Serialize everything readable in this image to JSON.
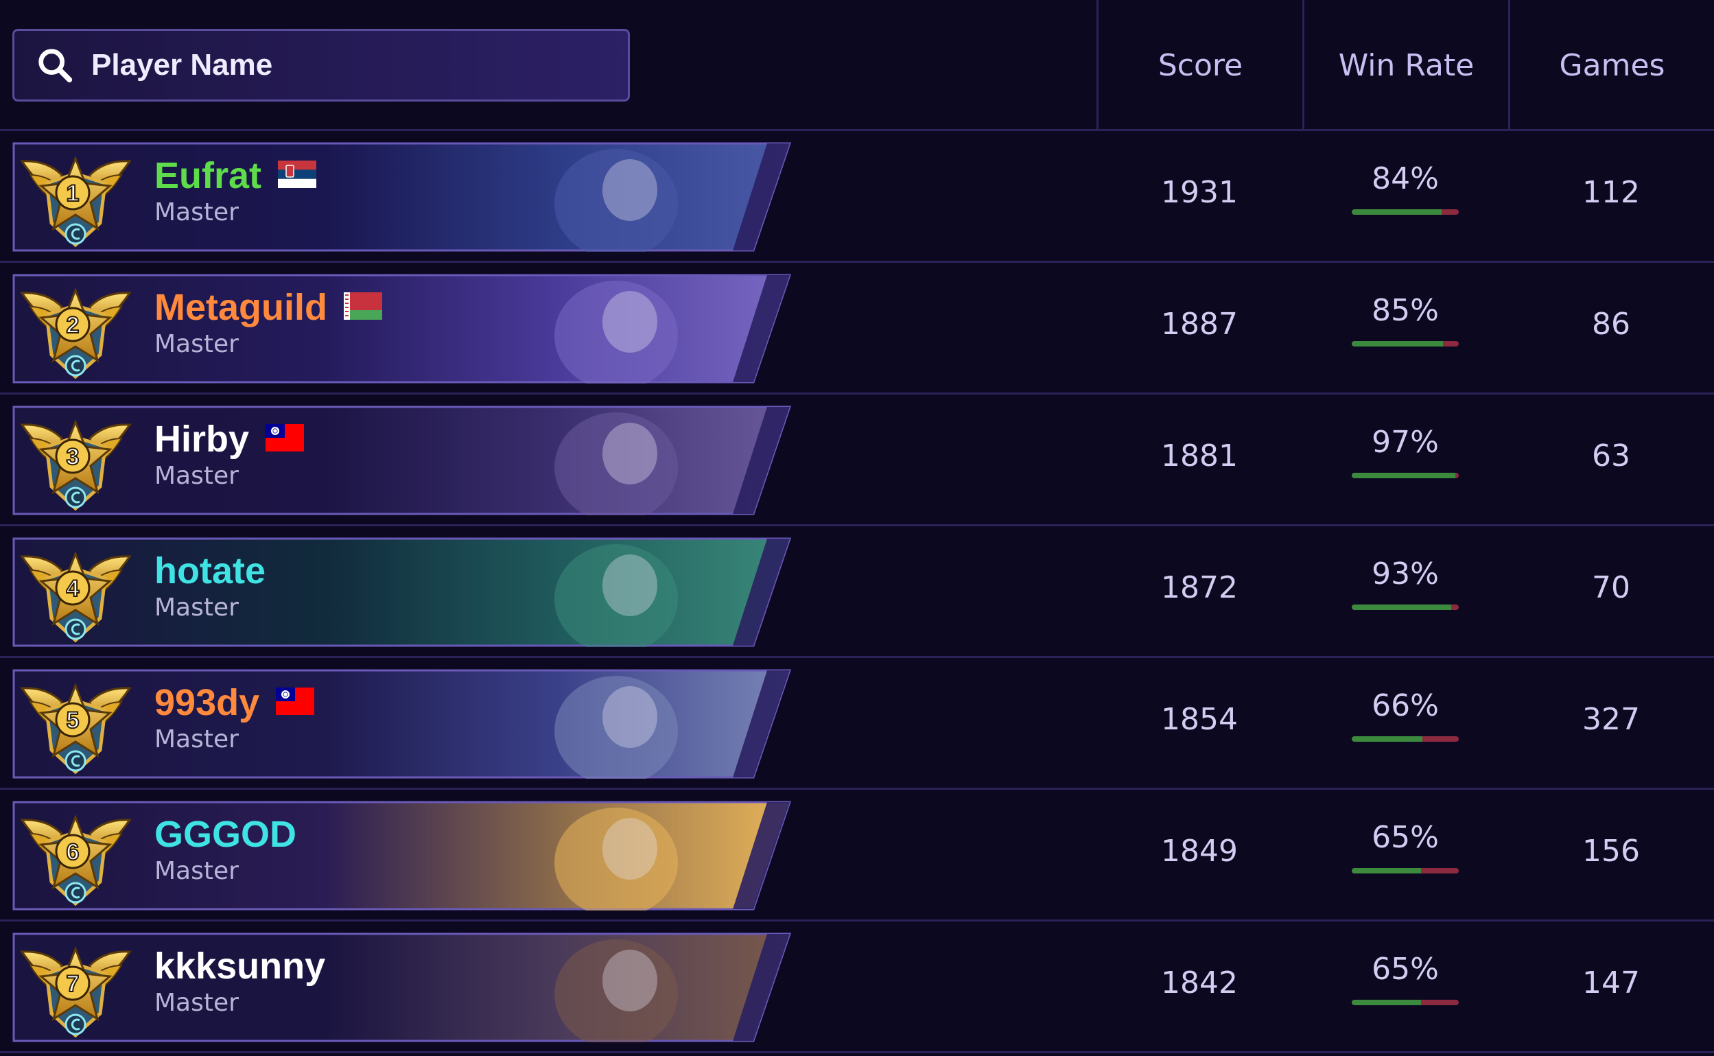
{
  "search": {
    "placeholder": "Player Name"
  },
  "columns": {
    "score": "Score",
    "win_rate": "Win Rate",
    "games": "Games"
  },
  "colors": {
    "background": "#0c0820",
    "banner_border": "#5a4c9c",
    "win_bar": "#3b8a3e",
    "loss_bar": "#8c2a40"
  },
  "players": [
    {
      "rank": "1",
      "name": "Eufrat",
      "name_color": "green",
      "flag": "serbia-flag",
      "tier": "Master",
      "score": "1931",
      "win_rate": "84%",
      "win_fraction": 0.84,
      "games": "112",
      "portrait": "hooded-masked-figure"
    },
    {
      "rank": "2",
      "name": "Metaguild",
      "name_color": "orange",
      "flag": "belarus-flag",
      "tier": "Master",
      "score": "1887",
      "win_rate": "85%",
      "win_fraction": 0.85,
      "games": "86",
      "portrait": "ghost-mask-figure"
    },
    {
      "rank": "3",
      "name": "Hirby",
      "name_color": "white",
      "flag": "taiwan-flag",
      "tier": "Master",
      "score": "1881",
      "win_rate": "97%",
      "win_fraction": 0.97,
      "games": "63",
      "portrait": "white-haired-warrior"
    },
    {
      "rank": "4",
      "name": "hotate",
      "name_color": "cyan",
      "flag": "",
      "tier": "Master",
      "score": "1872",
      "win_rate": "93%",
      "win_fraction": 0.93,
      "games": "70",
      "portrait": "green-dryad"
    },
    {
      "rank": "5",
      "name": "993dy",
      "name_color": "orange",
      "flag": "taiwan-flag",
      "tier": "Master",
      "score": "1854",
      "win_rate": "66%",
      "win_fraction": 0.66,
      "games": "327",
      "portrait": "cat-with-pipe"
    },
    {
      "rank": "6",
      "name": "GGGOD",
      "name_color": "cyan",
      "flag": "",
      "tier": "Master",
      "score": "1849",
      "win_rate": "65%",
      "win_fraction": 0.65,
      "games": "156",
      "portrait": "dark-cat-noble"
    },
    {
      "rank": "7",
      "name": "kkksunny",
      "name_color": "white",
      "flag": "",
      "tier": "Master",
      "score": "1842",
      "win_rate": "65%",
      "win_fraction": 0.65,
      "games": "147",
      "portrait": "masked-warrior"
    }
  ]
}
